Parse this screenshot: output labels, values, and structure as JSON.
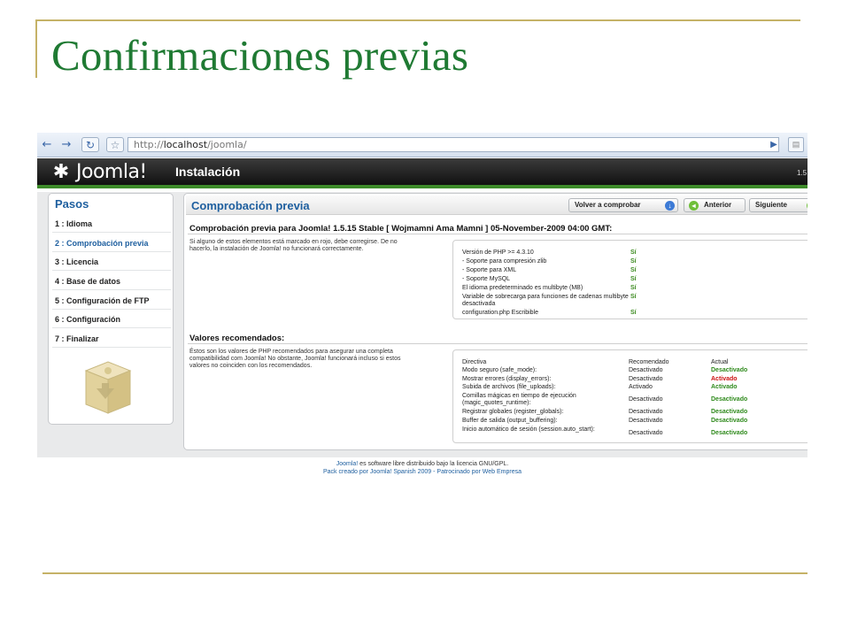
{
  "slide": {
    "title": "Confirmaciones previas"
  },
  "browser": {
    "url_prefix": "http://",
    "url_host": "localhost",
    "url_path": "/joomla/"
  },
  "header": {
    "logo_text": "Joomla!",
    "title": "Instalación",
    "version": "1.5"
  },
  "sidebar": {
    "title": "Pasos",
    "items": [
      {
        "label": "1 : Idioma",
        "active": false
      },
      {
        "label": "2 : Comprobación previa",
        "active": true
      },
      {
        "label": "3 : Licencia",
        "active": false
      },
      {
        "label": "4 : Base de datos",
        "active": false
      },
      {
        "label": "5 : Configuración de FTP",
        "active": false
      },
      {
        "label": "6 : Configuración",
        "active": false
      },
      {
        "label": "7 : Finalizar",
        "active": false
      }
    ]
  },
  "main": {
    "title": "Comprobación previa",
    "buttons": {
      "recheck": "Volver a comprobar",
      "prev": "Anterior",
      "next": "Siguiente"
    },
    "precheck": {
      "heading": "Comprobación previa para Joomla! 1.5.15 Stable [ Wojmamni Ama Mamni ] 05-November-2009 04:00 GMT:",
      "description": "Si alguno de estos elementos está marcado en rojo, debe corregirse. De no hacerlo, la instalación de Joomla! no funcionará correctamente.",
      "rows": [
        {
          "label": "Versión de PHP >= 4.3.10",
          "value": "Sí"
        },
        {
          "label": "- Soporte para compresión zlib",
          "value": "Sí"
        },
        {
          "label": "- Soporte para XML",
          "value": "Sí"
        },
        {
          "label": "- Soporte MySQL",
          "value": "Sí"
        },
        {
          "label": "El idioma predeterminado es multibyte (MB)",
          "value": "Sí"
        },
        {
          "label": "Variable de sobrecarga para funciones de cadenas multibyte desactivada",
          "value": "Sí"
        },
        {
          "label": "configuration.php Escribible",
          "value": "Sí"
        }
      ]
    },
    "recommended": {
      "heading": "Valores recomendados:",
      "description": "Éstos son los valores de PHP recomendados para asegurar una completa compatibilidad com Joomla! No obstante, Joomla! funcionará incluso si estos valores no coinciden con los recomendados.",
      "columns": {
        "directive": "Directiva",
        "recommended": "Recomendado",
        "actual": "Actual"
      },
      "rows": [
        {
          "directive": "Modo seguro (safe_mode):",
          "recommended": "Desactivado",
          "actual": "Desactivado",
          "status": "ok"
        },
        {
          "directive": "Mostrar errores (display_errors):",
          "recommended": "Desactivado",
          "actual": "Activado",
          "status": "bad"
        },
        {
          "directive": "Subida de archivos (file_uploads):",
          "recommended": "Activado",
          "actual": "Activado",
          "status": "ok"
        },
        {
          "directive": "Comillas mágicas en tiempo de ejecución (magic_quotes_runtime):",
          "recommended": "Desactivado",
          "actual": "Desactivado",
          "status": "ok"
        },
        {
          "directive": "Registrar globales (register_globals):",
          "recommended": "Desactivado",
          "actual": "Desactivado",
          "status": "ok"
        },
        {
          "directive": "Buffer de salida (output_buffering):",
          "recommended": "Desactivado",
          "actual": "Desactivado",
          "status": "ok"
        },
        {
          "directive": "Inicio automático de sesión (session.auto_start):",
          "recommended": "Desactivado",
          "actual": "Desactivado",
          "status": "ok"
        }
      ]
    }
  },
  "footer": {
    "line1_link": "Joomla!",
    "line1_rest": " es software libre distribuido bajo la licencia GNU/GPL.",
    "line2": "Pack creado por Joomla! Spanish 2009 - Patrocinado por Web Empresa"
  },
  "colors": {
    "ok": "#2f8a1c",
    "bad": "#cc1111",
    "accent": "#1e5f9f",
    "title": "#1f7a33"
  }
}
